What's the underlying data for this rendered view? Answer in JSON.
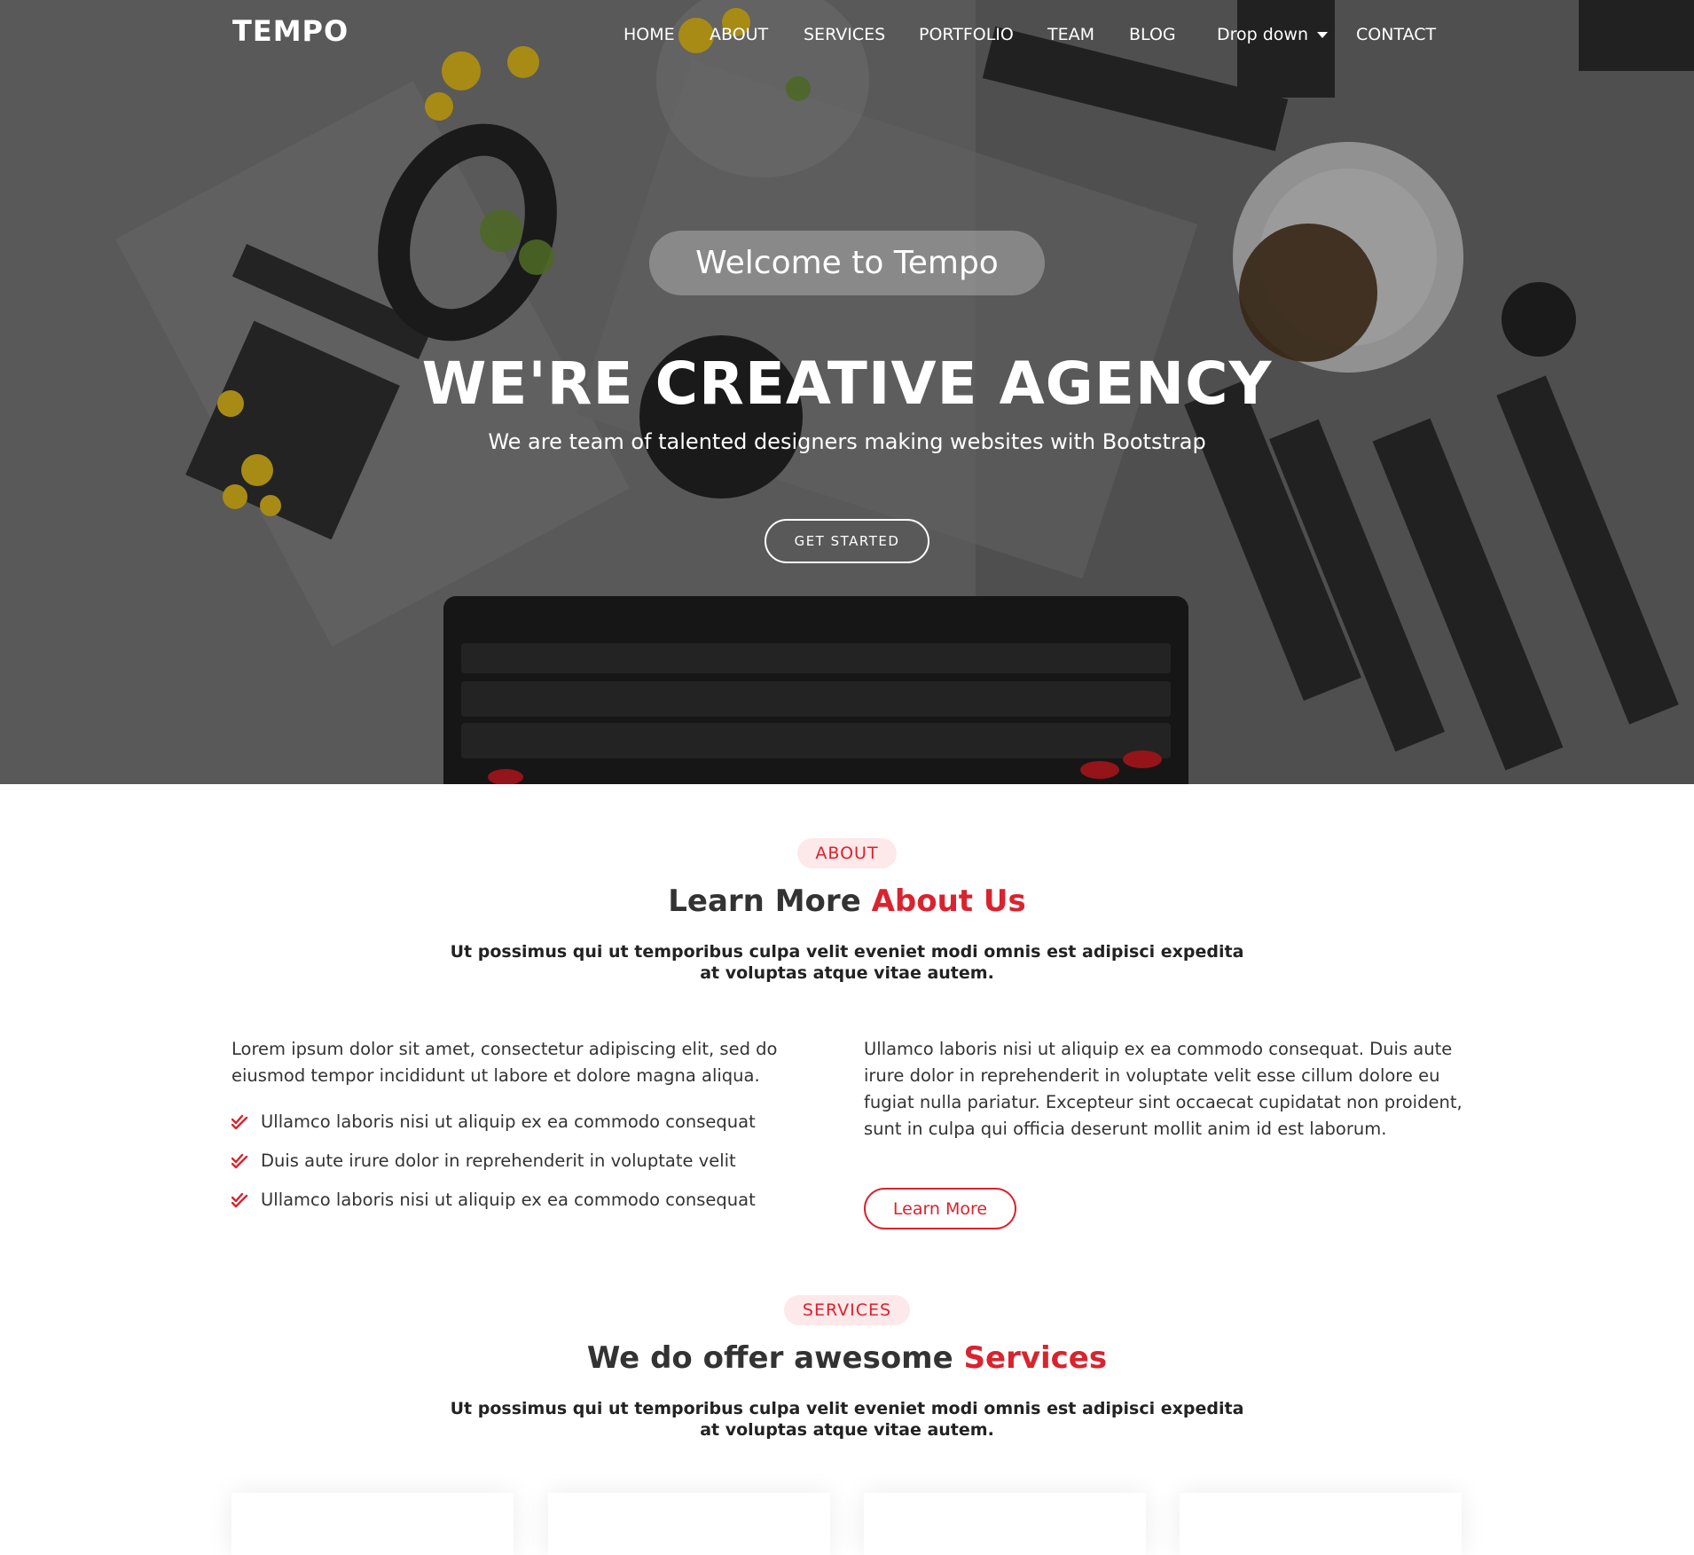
{
  "brand": "TEMPO",
  "nav": {
    "home": "HOME",
    "about": "ABOUT",
    "services": "SERVICES",
    "portfolio": "PORTFOLIO",
    "team": "TEAM",
    "blog": "BLOG",
    "dropdown": "Drop down",
    "contact": "CONTACT"
  },
  "hero": {
    "welcome": "Welcome to Tempo",
    "title": "WE'RE CREATIVE AGENCY",
    "subtitle": "We are team of talented designers making websites with Bootstrap",
    "cta": "GET STARTED"
  },
  "about": {
    "badge": "ABOUT",
    "title_plain": "Learn More ",
    "title_accent": "About Us",
    "lead": "Ut possimus qui ut temporibus culpa velit eveniet modi omnis est adipisci expedita at voluptas atque vitae autem.",
    "left_paragraph": "Lorem ipsum dolor sit amet, consectetur adipiscing elit, sed do eiusmod tempor incididunt ut labore et dolore magna aliqua.",
    "list": [
      "Ullamco laboris nisi ut aliquip ex ea commodo consequat",
      "Duis aute irure dolor in reprehenderit in voluptate velit",
      "Ullamco laboris nisi ut aliquip ex ea commodo consequat"
    ],
    "right_paragraph": "Ullamco laboris nisi ut aliquip ex ea commodo consequat. Duis aute irure dolor in reprehenderit in voluptate velit esse cillum dolore eu fugiat nulla pariatur. Excepteur sint occaecat cupidatat non proident, sunt in culpa qui officia deserunt mollit anim id est laborum.",
    "button": "Learn More"
  },
  "services": {
    "badge": "SERVICES",
    "title_plain": "We do offer awesome ",
    "title_accent": "Services",
    "lead": "Ut possimus qui ut temporibus culpa velit eveniet modi omnis est adipisci expedita at voluptas atque vitae autem."
  },
  "colors": {
    "accent": "#d9232e",
    "badge_bg": "#fde8ea",
    "heading": "#333333"
  },
  "icons": {
    "check": "double-check-icon",
    "dropdown": "caret-down-icon"
  }
}
